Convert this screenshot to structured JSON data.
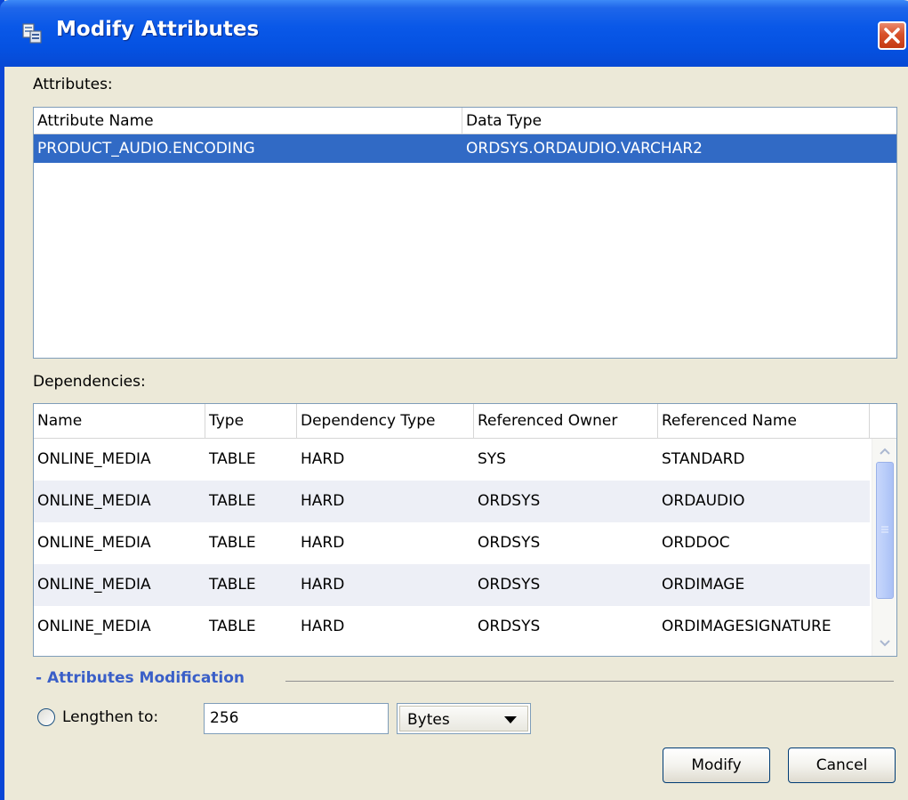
{
  "window": {
    "title": "Modify Attributes"
  },
  "attributes": {
    "label": "Attributes:",
    "columns": [
      "Attribute Name",
      "Data Type"
    ],
    "rows": [
      [
        "PRODUCT_AUDIO.ENCODING",
        "ORDSYS.ORDAUDIO.VARCHAR2"
      ]
    ]
  },
  "dependencies": {
    "label": "Dependencies:",
    "columns": [
      "Name",
      "Type",
      "Dependency Type",
      "Referenced Owner",
      "Referenced Name"
    ],
    "rows": [
      [
        "ONLINE_MEDIA",
        "TABLE",
        "HARD",
        "SYS",
        "STANDARD"
      ],
      [
        "ONLINE_MEDIA",
        "TABLE",
        "HARD",
        "ORDSYS",
        "ORDAUDIO"
      ],
      [
        "ONLINE_MEDIA",
        "TABLE",
        "HARD",
        "ORDSYS",
        "ORDDOC"
      ],
      [
        "ONLINE_MEDIA",
        "TABLE",
        "HARD",
        "ORDSYS",
        "ORDIMAGE"
      ],
      [
        "ONLINE_MEDIA",
        "TABLE",
        "HARD",
        "ORDSYS",
        "ORDIMAGESIGNATURE"
      ]
    ]
  },
  "modification": {
    "group_title": "- Attributes Modification",
    "lengthen_label": "Lengthen to:",
    "length_value": "256",
    "unit_selected": "Bytes"
  },
  "buttons": {
    "modify": "Modify",
    "cancel": "Cancel"
  },
  "colors": {
    "titlebar": "#0a58e8",
    "selection": "#316ac5",
    "group_title": "#3a5fc8",
    "close_button": "#d8512a"
  }
}
